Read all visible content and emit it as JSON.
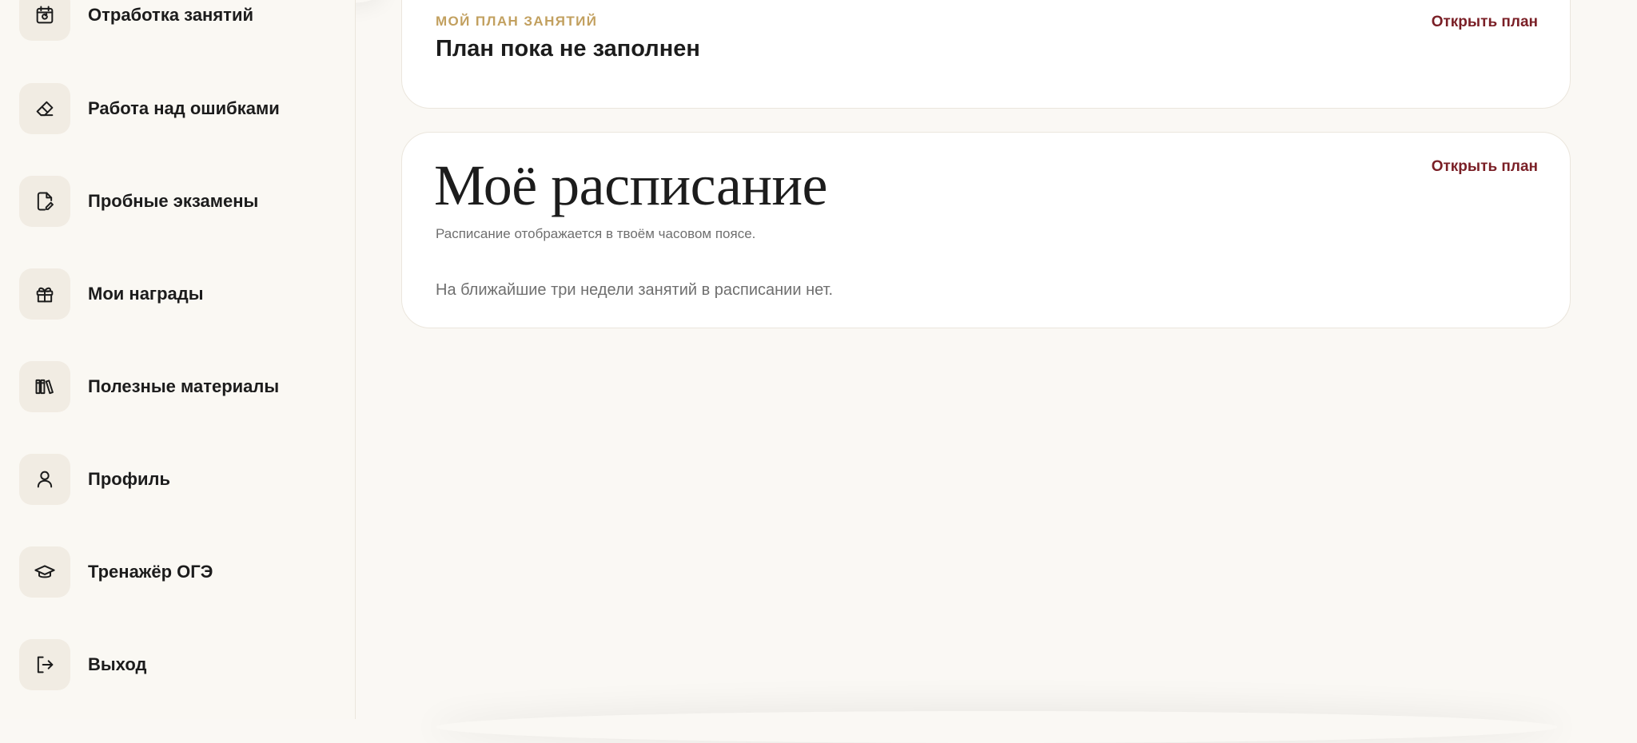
{
  "sidebar": {
    "items": [
      {
        "label": "Отработка занятий",
        "icon": "calendar-refresh-icon"
      },
      {
        "label": "Работа над ошибками",
        "icon": "eraser-icon"
      },
      {
        "label": "Пробные экзамены",
        "icon": "document-edit-icon"
      },
      {
        "label": "Мои награды",
        "icon": "gift-icon"
      },
      {
        "label": "Полезные материалы",
        "icon": "books-icon"
      },
      {
        "label": "Профиль",
        "icon": "user-icon"
      },
      {
        "label": "Тренажёр ОГЭ",
        "icon": "graduation-cap-icon"
      },
      {
        "label": "Выход",
        "icon": "logout-icon"
      }
    ]
  },
  "plan_card": {
    "eyebrow": "МОЙ ПЛАН ЗАНЯТИЙ",
    "title": "План пока не заполнен",
    "link": "Открыть план"
  },
  "schedule_card": {
    "title": "Моё расписание",
    "subtitle": "Расписание отображается в твоём часовом поясе.",
    "empty_text": "На ближайшие три недели занятий в расписании нет.",
    "link": "Открыть план"
  },
  "colors": {
    "background": "#faf8f4",
    "accent_gold": "#c2a05f",
    "link_maroon": "#7a1f26",
    "icon_bg": "#f1ece3"
  }
}
